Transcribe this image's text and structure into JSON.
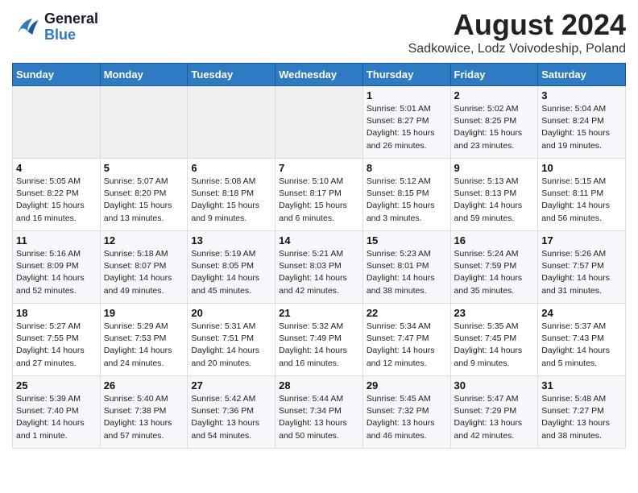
{
  "logo": {
    "text_general": "General",
    "text_blue": "Blue"
  },
  "title": "August 2024",
  "location": "Sadkowice, Lodz Voivodeship, Poland",
  "days_of_week": [
    "Sunday",
    "Monday",
    "Tuesday",
    "Wednesday",
    "Thursday",
    "Friday",
    "Saturday"
  ],
  "weeks": [
    [
      {
        "day": "",
        "info": ""
      },
      {
        "day": "",
        "info": ""
      },
      {
        "day": "",
        "info": ""
      },
      {
        "day": "",
        "info": ""
      },
      {
        "day": "1",
        "info": "Sunrise: 5:01 AM\nSunset: 8:27 PM\nDaylight: 15 hours\nand 26 minutes."
      },
      {
        "day": "2",
        "info": "Sunrise: 5:02 AM\nSunset: 8:25 PM\nDaylight: 15 hours\nand 23 minutes."
      },
      {
        "day": "3",
        "info": "Sunrise: 5:04 AM\nSunset: 8:24 PM\nDaylight: 15 hours\nand 19 minutes."
      }
    ],
    [
      {
        "day": "4",
        "info": "Sunrise: 5:05 AM\nSunset: 8:22 PM\nDaylight: 15 hours\nand 16 minutes."
      },
      {
        "day": "5",
        "info": "Sunrise: 5:07 AM\nSunset: 8:20 PM\nDaylight: 15 hours\nand 13 minutes."
      },
      {
        "day": "6",
        "info": "Sunrise: 5:08 AM\nSunset: 8:18 PM\nDaylight: 15 hours\nand 9 minutes."
      },
      {
        "day": "7",
        "info": "Sunrise: 5:10 AM\nSunset: 8:17 PM\nDaylight: 15 hours\nand 6 minutes."
      },
      {
        "day": "8",
        "info": "Sunrise: 5:12 AM\nSunset: 8:15 PM\nDaylight: 15 hours\nand 3 minutes."
      },
      {
        "day": "9",
        "info": "Sunrise: 5:13 AM\nSunset: 8:13 PM\nDaylight: 14 hours\nand 59 minutes."
      },
      {
        "day": "10",
        "info": "Sunrise: 5:15 AM\nSunset: 8:11 PM\nDaylight: 14 hours\nand 56 minutes."
      }
    ],
    [
      {
        "day": "11",
        "info": "Sunrise: 5:16 AM\nSunset: 8:09 PM\nDaylight: 14 hours\nand 52 minutes."
      },
      {
        "day": "12",
        "info": "Sunrise: 5:18 AM\nSunset: 8:07 PM\nDaylight: 14 hours\nand 49 minutes."
      },
      {
        "day": "13",
        "info": "Sunrise: 5:19 AM\nSunset: 8:05 PM\nDaylight: 14 hours\nand 45 minutes."
      },
      {
        "day": "14",
        "info": "Sunrise: 5:21 AM\nSunset: 8:03 PM\nDaylight: 14 hours\nand 42 minutes."
      },
      {
        "day": "15",
        "info": "Sunrise: 5:23 AM\nSunset: 8:01 PM\nDaylight: 14 hours\nand 38 minutes."
      },
      {
        "day": "16",
        "info": "Sunrise: 5:24 AM\nSunset: 7:59 PM\nDaylight: 14 hours\nand 35 minutes."
      },
      {
        "day": "17",
        "info": "Sunrise: 5:26 AM\nSunset: 7:57 PM\nDaylight: 14 hours\nand 31 minutes."
      }
    ],
    [
      {
        "day": "18",
        "info": "Sunrise: 5:27 AM\nSunset: 7:55 PM\nDaylight: 14 hours\nand 27 minutes."
      },
      {
        "day": "19",
        "info": "Sunrise: 5:29 AM\nSunset: 7:53 PM\nDaylight: 14 hours\nand 24 minutes."
      },
      {
        "day": "20",
        "info": "Sunrise: 5:31 AM\nSunset: 7:51 PM\nDaylight: 14 hours\nand 20 minutes."
      },
      {
        "day": "21",
        "info": "Sunrise: 5:32 AM\nSunset: 7:49 PM\nDaylight: 14 hours\nand 16 minutes."
      },
      {
        "day": "22",
        "info": "Sunrise: 5:34 AM\nSunset: 7:47 PM\nDaylight: 14 hours\nand 12 minutes."
      },
      {
        "day": "23",
        "info": "Sunrise: 5:35 AM\nSunset: 7:45 PM\nDaylight: 14 hours\nand 9 minutes."
      },
      {
        "day": "24",
        "info": "Sunrise: 5:37 AM\nSunset: 7:43 PM\nDaylight: 14 hours\nand 5 minutes."
      }
    ],
    [
      {
        "day": "25",
        "info": "Sunrise: 5:39 AM\nSunset: 7:40 PM\nDaylight: 14 hours\nand 1 minute."
      },
      {
        "day": "26",
        "info": "Sunrise: 5:40 AM\nSunset: 7:38 PM\nDaylight: 13 hours\nand 57 minutes."
      },
      {
        "day": "27",
        "info": "Sunrise: 5:42 AM\nSunset: 7:36 PM\nDaylight: 13 hours\nand 54 minutes."
      },
      {
        "day": "28",
        "info": "Sunrise: 5:44 AM\nSunset: 7:34 PM\nDaylight: 13 hours\nand 50 minutes."
      },
      {
        "day": "29",
        "info": "Sunrise: 5:45 AM\nSunset: 7:32 PM\nDaylight: 13 hours\nand 46 minutes."
      },
      {
        "day": "30",
        "info": "Sunrise: 5:47 AM\nSunset: 7:29 PM\nDaylight: 13 hours\nand 42 minutes."
      },
      {
        "day": "31",
        "info": "Sunrise: 5:48 AM\nSunset: 7:27 PM\nDaylight: 13 hours\nand 38 minutes."
      }
    ]
  ]
}
